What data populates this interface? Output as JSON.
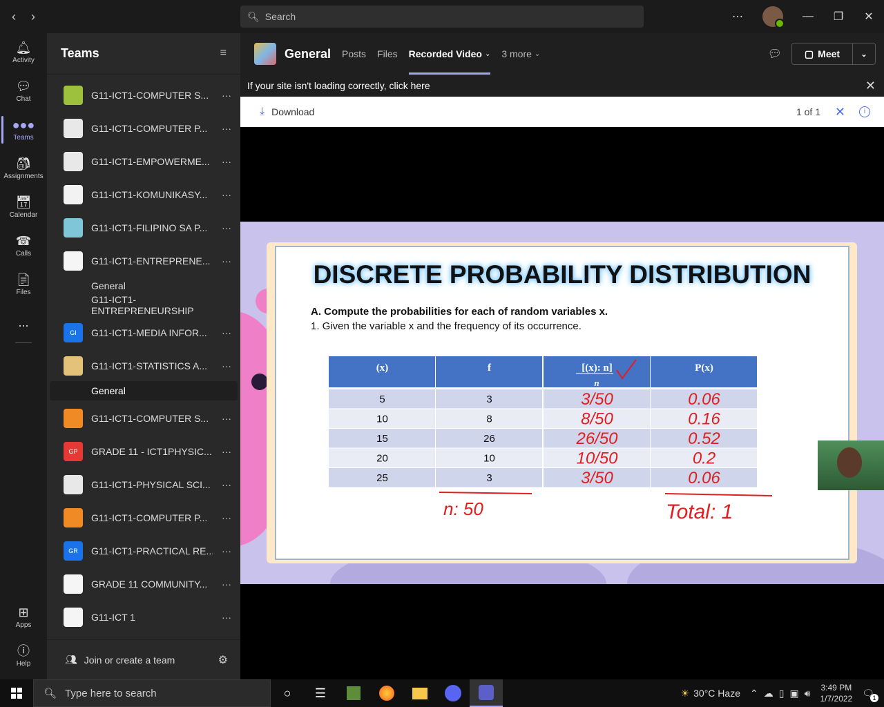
{
  "search": {
    "placeholder": "Search"
  },
  "rail": [
    {
      "label": "Activity",
      "icon": "bell-icon"
    },
    {
      "label": "Chat",
      "icon": "chat-icon"
    },
    {
      "label": "Teams",
      "icon": "teams-icon"
    },
    {
      "label": "Assignments",
      "icon": "assignments-icon"
    },
    {
      "label": "Calendar",
      "icon": "calendar-icon"
    },
    {
      "label": "Calls",
      "icon": "phone-icon"
    },
    {
      "label": "Files",
      "icon": "file-icon"
    },
    {
      "label": "...",
      "icon": "more-icon"
    },
    {
      "label": "Apps",
      "icon": "apps-icon"
    },
    {
      "label": "Help",
      "icon": "help-icon"
    }
  ],
  "sidebar": {
    "title": "Teams",
    "teams": [
      {
        "name": "G11-ICT1-COMPUTER S...",
        "color": "#9dc13d"
      },
      {
        "name": "G11-ICT1-COMPUTER P...",
        "color": "#e8e8e8"
      },
      {
        "name": "G11-ICT1-EMPOWERME...",
        "color": "#e8e8e8"
      },
      {
        "name": "G11-ICT1-KOMUNIKASY...",
        "color": "#f2f2f2"
      },
      {
        "name": "G11-ICT1-FILIPINO SA P...",
        "color": "#7fc6d8"
      },
      {
        "name": "G11-ICT1-ENTREPRENE...",
        "color": "#f5f5f5"
      },
      {
        "name": "G11-ICT1-MEDIA INFOR...",
        "color": "#1a73e8",
        "abbr": "GI"
      },
      {
        "name": "G11-ICT1-STATISTICS A...",
        "color": "#e4c27a"
      },
      {
        "name": "G11-ICT1-COMPUTER S...",
        "color": "#f08a24"
      },
      {
        "name": "GRADE 11 - ICT1PHYSIC...",
        "color": "#e53935",
        "abbr": "GP"
      },
      {
        "name": "G11-ICT1-PHYSICAL SCI...",
        "color": "#e8e8e8"
      },
      {
        "name": "G11-ICT1-COMPUTER P...",
        "color": "#f08a24"
      },
      {
        "name": "G11-ICT1-PRACTICAL RE...",
        "color": "#1a73e8",
        "abbr": "GR"
      },
      {
        "name": "GRADE 11 COMMUNITY...",
        "color": "#f5f5f5"
      },
      {
        "name": "G11-ICT 1",
        "color": "#f5f5f5"
      }
    ],
    "channels": {
      "general_a": "General",
      "entre": "G11-ICT1-ENTREPRENEURSHIP",
      "general_b": "General"
    },
    "more": "···",
    "join": "Join or create a team"
  },
  "channel": {
    "name": "General",
    "tabs": [
      "Posts",
      "Files",
      "Recorded Video",
      "3 more"
    ],
    "meet": "Meet"
  },
  "banner": {
    "text": "If your site isn't loading correctly, click here"
  },
  "viewer": {
    "download": "Download",
    "count": "1 of 1"
  },
  "slide": {
    "title": "DISCRETE PROBABILITY DISTRIBUTION",
    "instruction": "A.  Compute the probabilities for each of random variables x.",
    "sub": "1. Given the variable x and the frequency of its occurrence.",
    "headers": [
      "(x)",
      "f",
      "[(x): n]",
      "P(x)"
    ],
    "header_sub": "n",
    "rows": [
      {
        "x": "5",
        "f": "3",
        "ratio": "3/50",
        "p": "0.06"
      },
      {
        "x": "10",
        "f": "8",
        "ratio": "8/50",
        "p": "0.16"
      },
      {
        "x": "15",
        "f": "26",
        "ratio": "26/50",
        "p": "0.52"
      },
      {
        "x": "20",
        "f": "10",
        "ratio": "10/50",
        "p": "0.2"
      },
      {
        "x": "25",
        "f": "3",
        "ratio": "3/50",
        "p": "0.06"
      }
    ],
    "n_note": "n: 50",
    "total_note": "Total: 1"
  },
  "taskbar": {
    "search": "Type here to search",
    "weather": "30°C  Haze",
    "time": "3:49 PM",
    "date": "1/7/2022",
    "notif": "1"
  }
}
